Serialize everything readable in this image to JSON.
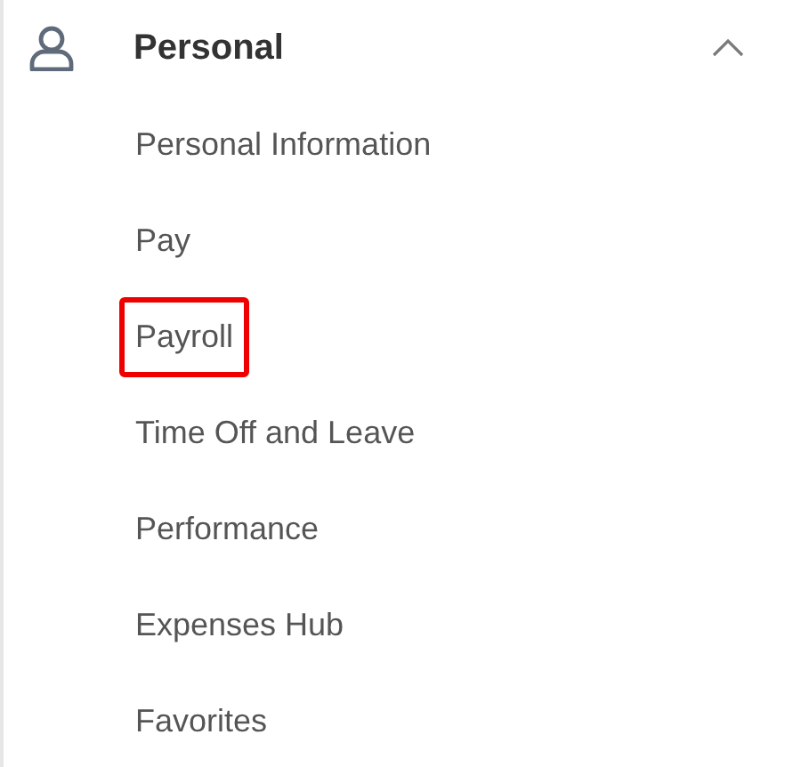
{
  "section": {
    "title": "Personal",
    "expanded": true
  },
  "items": [
    {
      "label": "Personal Information",
      "highlighted": false
    },
    {
      "label": "Pay",
      "highlighted": false
    },
    {
      "label": "Payroll",
      "highlighted": true
    },
    {
      "label": "Time Off and Leave",
      "highlighted": false
    },
    {
      "label": "Performance",
      "highlighted": false
    },
    {
      "label": "Expenses Hub",
      "highlighted": false
    },
    {
      "label": "Favorites",
      "highlighted": false
    }
  ]
}
